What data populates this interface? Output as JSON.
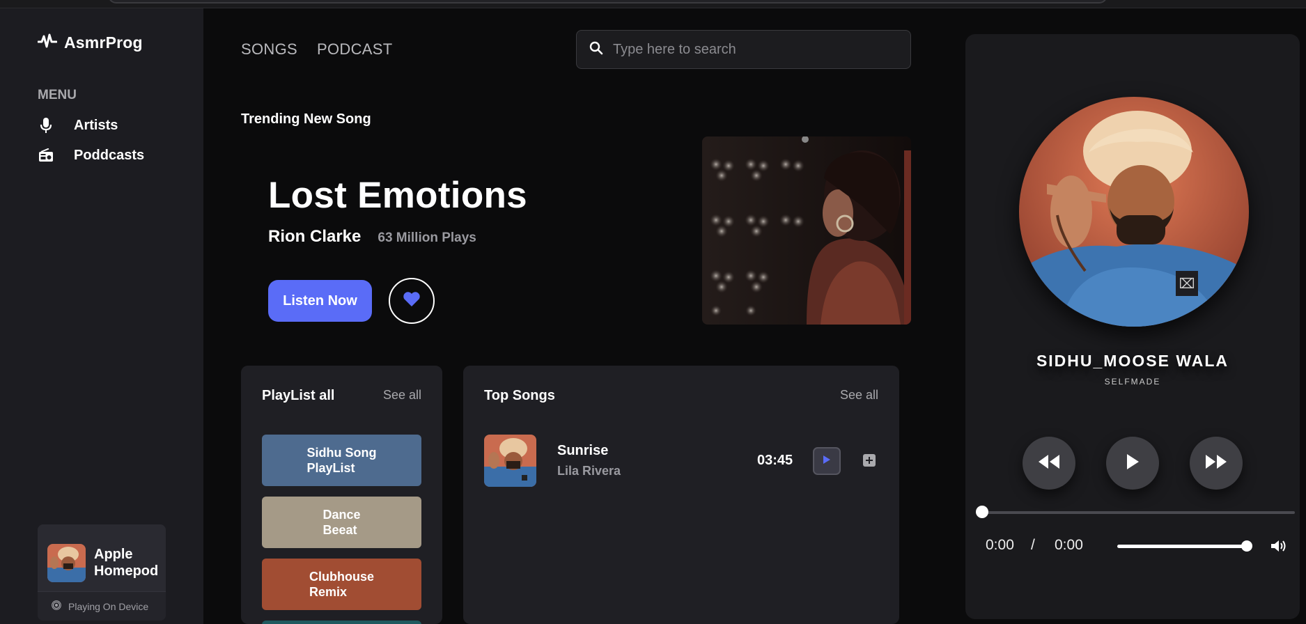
{
  "app": {
    "name": "AsmrProg"
  },
  "sidebar": {
    "menu_label": "MENU",
    "items": [
      {
        "label": "Artists",
        "icon": "microphone-icon"
      },
      {
        "label": "Poddcasts",
        "icon": "radio-icon"
      }
    ],
    "device": {
      "name": "Apple Homepod",
      "status": "Playing On Device"
    }
  },
  "header": {
    "tabs": [
      {
        "label": "SONGS"
      },
      {
        "label": "PODCAST"
      }
    ],
    "search": {
      "placeholder": "Type here to search",
      "value": ""
    }
  },
  "hero": {
    "section_label": "Trending New Song",
    "title": "Lost Emotions",
    "artist": "Rion Clarke",
    "plays": "63 Million Plays",
    "listen_label": "Listen Now"
  },
  "playlists": {
    "title": "PlayList all",
    "see_all": "See all",
    "items": [
      {
        "label": "Sidhu Song\nPlayList",
        "color": "#4e6b8f"
      },
      {
        "label": "Dance\nBeeat",
        "color": "#a59a87"
      },
      {
        "label": "Clubhouse\nRemix",
        "color": "#a14d33"
      }
    ]
  },
  "top_songs": {
    "title": "Top Songs",
    "see_all": "See all",
    "items": [
      {
        "title": "Sunrise",
        "artist": "Lila Rivera",
        "duration": "03:45"
      }
    ]
  },
  "player": {
    "artist": "SIDHU_MOOSE WALA",
    "album": "SELFMADE",
    "current_time": "0:00",
    "separator": "/",
    "total_time": "0:00",
    "progress": 0,
    "volume": 1.0
  },
  "colors": {
    "accent": "#5a6cf7",
    "background": "#0b0b0c",
    "sidebar": "#1c1c21",
    "panel": "#1f1f24"
  }
}
